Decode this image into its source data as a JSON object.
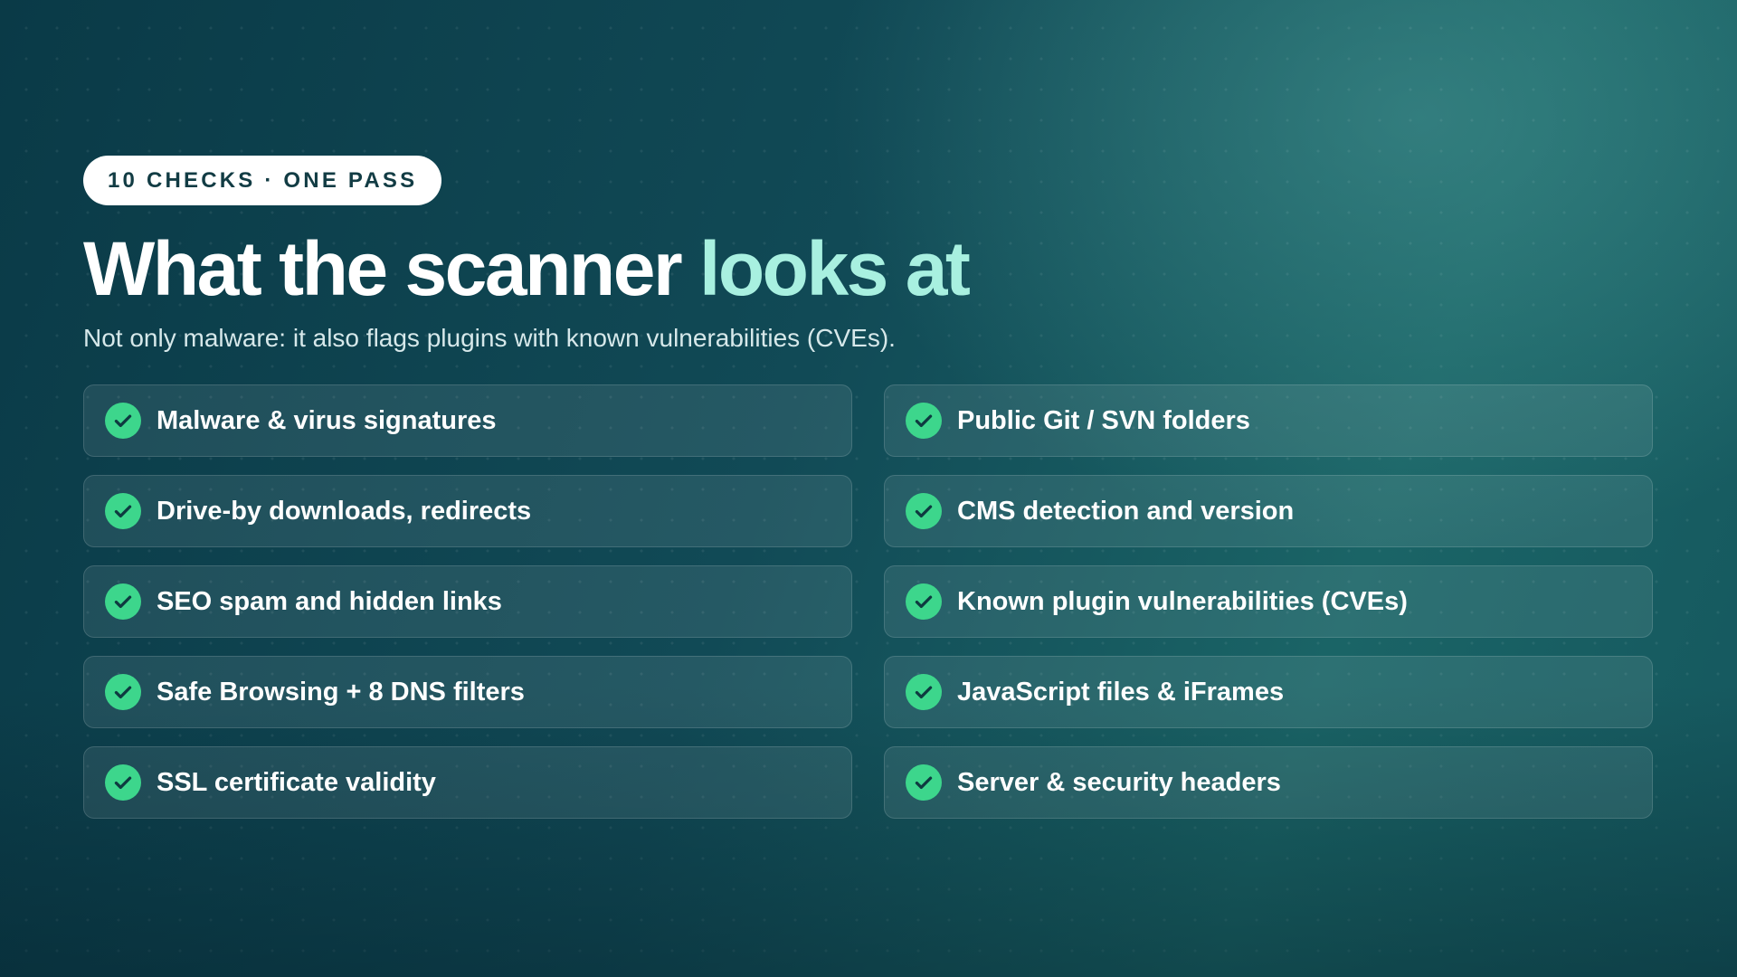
{
  "badge": {
    "label": "10 CHECKS · ONE PASS"
  },
  "heading": {
    "main": "What the scanner",
    "accent": "looks at"
  },
  "subtitle": "Not only malware: it also flags plugins with known vulnerabilities (CVEs).",
  "colors": {
    "accent": "#a8f0e0",
    "check": "#3dd68c",
    "badge_text": "#123c44"
  },
  "icon": "check-circle-icon",
  "checks": {
    "left": [
      "Malware & virus signatures",
      "Drive-by downloads, redirects",
      "SEO spam and hidden links",
      "Safe Browsing + 8 DNS filters",
      "SSL certificate validity"
    ],
    "right": [
      "Public Git / SVN folders",
      "CMS detection and version",
      "Known plugin vulnerabilities (CVEs)",
      "JavaScript files & iFrames",
      "Server & security headers"
    ]
  }
}
